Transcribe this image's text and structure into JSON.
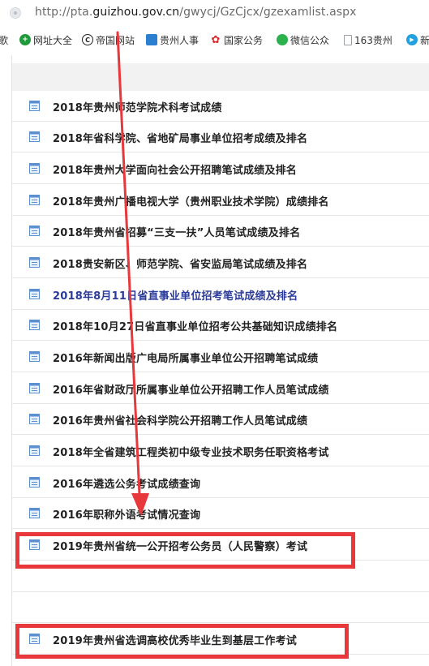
{
  "address_bar": {
    "url_prefix": "http://pta.",
    "url_domain": "guizhou.gov.cn",
    "url_path": "/gwycj/GzCjcx/gzexamlist.aspx"
  },
  "bookmarks": [
    {
      "label": "歌",
      "icon": "",
      "color": ""
    },
    {
      "label": "网址大全",
      "icon": "plus-globe-icon",
      "color": "#1f9a3b"
    },
    {
      "label": "帝国网站",
      "icon": "c-logo-icon",
      "color": "#222222"
    },
    {
      "label": "贵州人事",
      "icon": "book-icon",
      "color": "#2b7fd1"
    },
    {
      "label": "国家公务",
      "icon": "emblem-icon",
      "color": "#d8262c"
    },
    {
      "label": "微信公众",
      "icon": "wechat-icon",
      "color": "#2bb24c"
    },
    {
      "label": "163贵州",
      "icon": "page-icon",
      "color": "#9aa0a6"
    },
    {
      "label": "新",
      "icon": "play-icon",
      "color": "#23a0e0"
    }
  ],
  "exam_list": {
    "items": [
      {
        "title": "2018年贵州师范学院术科考试成绩",
        "visited": false
      },
      {
        "title": "2018年省科学院、省地矿局事业单位招考成绩及排名",
        "visited": false
      },
      {
        "title": "2018年贵州大学面向社会公开招聘笔试成绩及排名",
        "visited": false
      },
      {
        "title": "2018年贵州广播电视大学（贵州职业技术学院）成绩排名",
        "visited": false
      },
      {
        "title": "2018年贵州省招募“三支一扶”人员笔试成绩及排名",
        "visited": false
      },
      {
        "title": "2018贵安新区、师范学院、省安监局笔试成绩及排名",
        "visited": false
      },
      {
        "title": "2018年8月11日省直事业单位招考笔试成绩及排名",
        "visited": true
      },
      {
        "title": "2018年10月27日省直事业单位招考公共基础知识成绩排名",
        "visited": false
      },
      {
        "title": "2016年新闻出版广电局所属事业单位公开招聘笔试成绩",
        "visited": false
      },
      {
        "title": "2016年省财政厅所属事业单位公开招聘工作人员笔试成绩",
        "visited": false
      },
      {
        "title": "2016年贵州省社会科学院公开招聘工作人员笔试成绩",
        "visited": false
      },
      {
        "title": "2018年全省建筑工程类初中级专业技术职务任职资格考试",
        "visited": false
      },
      {
        "title": "2016年遴选公务考试成绩查询",
        "visited": false
      },
      {
        "title": "2016年职称外语考试情况查询",
        "visited": false
      },
      {
        "title": "2019年贵州省统一公开招考公务员（人民警察）考试",
        "visited": false,
        "highlighted": true
      },
      {
        "title": "",
        "visited": false
      },
      {
        "title": "",
        "visited": false
      },
      {
        "title": "2019年贵州省选调高校优秀毕业生到基层工作考试",
        "visited": false,
        "highlighted": true
      }
    ]
  },
  "annotation": {
    "highlight_color": "#e8383b",
    "arrow_color": "#e8383b"
  },
  "colors": {
    "visited_link": "#2b3b9a",
    "link": "#222222",
    "icon": "#5b8fd0"
  }
}
